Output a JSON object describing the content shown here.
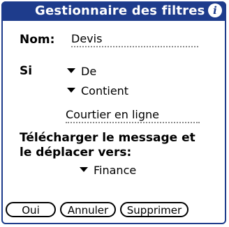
{
  "dialog": {
    "title": "Gestionnaire des filtres",
    "info_glyph": "i"
  },
  "form": {
    "name_label": "Nom:",
    "name_value": "Devis",
    "if_label": "Si",
    "field_popup": "De",
    "condition_popup": "Contient",
    "match_value": "Courtier en ligne",
    "action_line1": "Télécharger le message et",
    "action_line2": "le déplacer vers:",
    "folder_popup": "Finance"
  },
  "buttons": {
    "ok": "Oui",
    "cancel": "Annuler",
    "delete": "Supprimer"
  },
  "colors": {
    "titlebar": "#1e3c8c"
  },
  "icons": {
    "info": "info-icon",
    "popup": "triangle-down-icon"
  }
}
